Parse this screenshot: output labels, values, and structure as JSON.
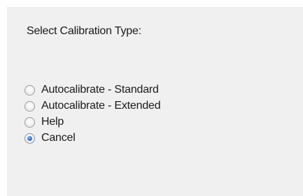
{
  "dialog": {
    "prompt": "Select Calibration Type:",
    "options": [
      {
        "label": "Autocalibrate - Standard",
        "checked": false
      },
      {
        "label": "Autocalibrate - Extended",
        "checked": false
      },
      {
        "label": "Help",
        "checked": false
      },
      {
        "label": "Cancel",
        "checked": true
      }
    ]
  },
  "colors": {
    "panel_background": "#f0f0f0",
    "page_background": "#ffffff",
    "selected_dot": "#3b74c4"
  }
}
